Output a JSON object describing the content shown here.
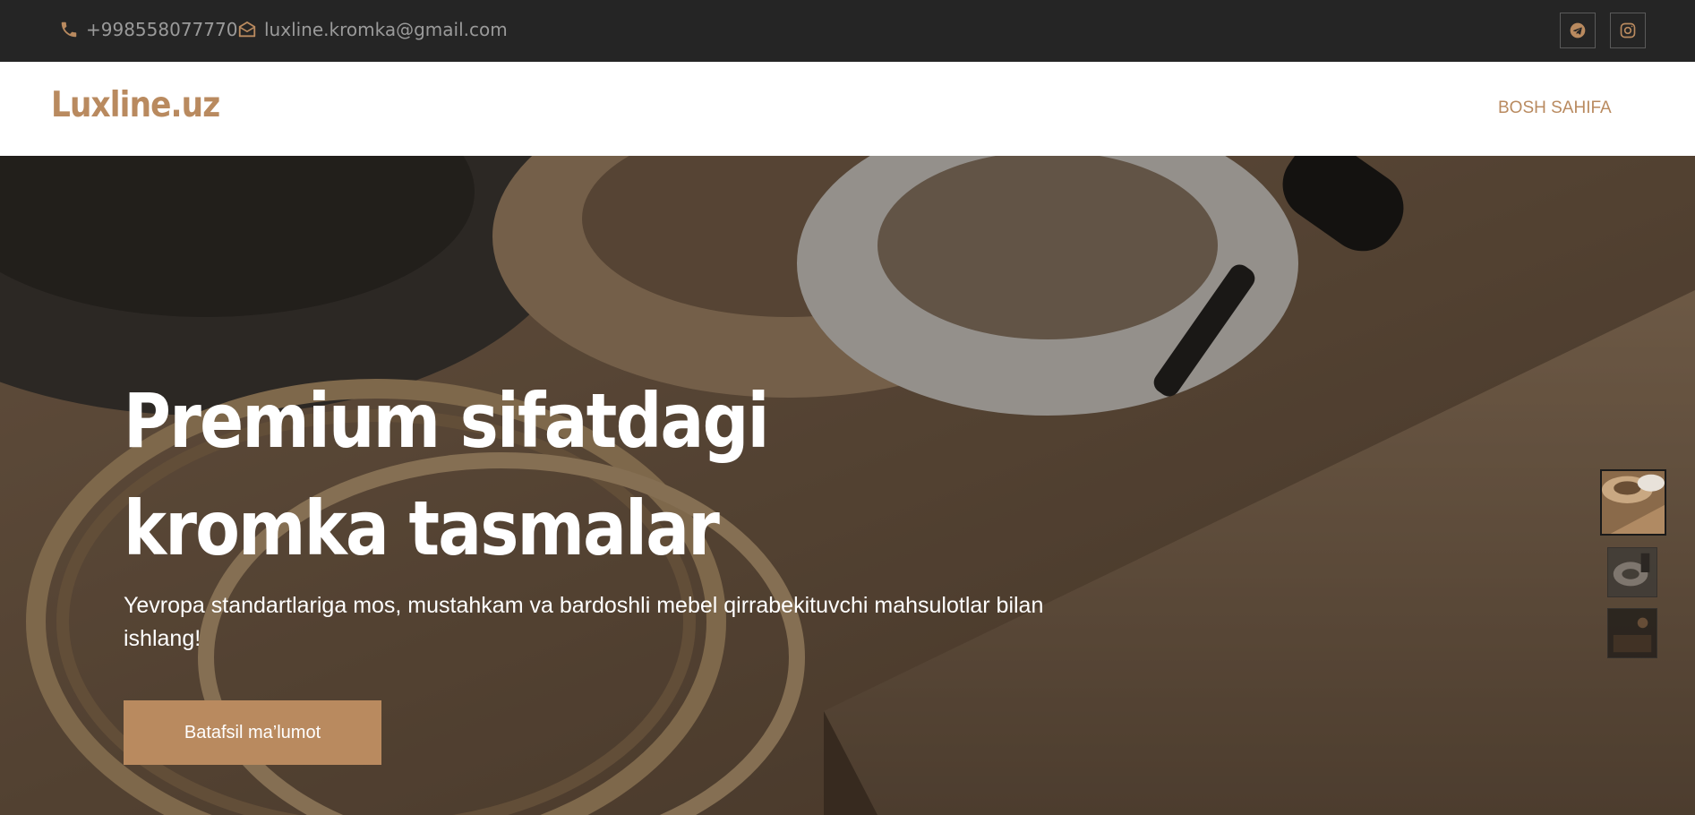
{
  "topbar": {
    "phone": "+998558077770",
    "email": "luxline.kromka@gmail.com",
    "phone_icon": "phone-icon",
    "email_icon": "envelope-icon",
    "social": [
      "telegram-icon",
      "instagram-icon"
    ]
  },
  "header": {
    "logo": "Luxline.uz",
    "nav": {
      "home": "BOSH SAHIFA"
    }
  },
  "hero": {
    "title": "Premium sifatdagi kromka tasmalar",
    "subtitle": "Yevropa standartlariga mos, mustahkam va bardoshli mebel qirrabekituvchi mahsulotlar bilan ishlang!",
    "cta": "Batafsil ma’lumot",
    "slides_count": 3,
    "active_slide": 1
  },
  "colors": {
    "accent": "#b98a5f",
    "topbar_bg": "#252525",
    "header_bg": "#ffffff",
    "muted_text": "#9a9a9a"
  }
}
